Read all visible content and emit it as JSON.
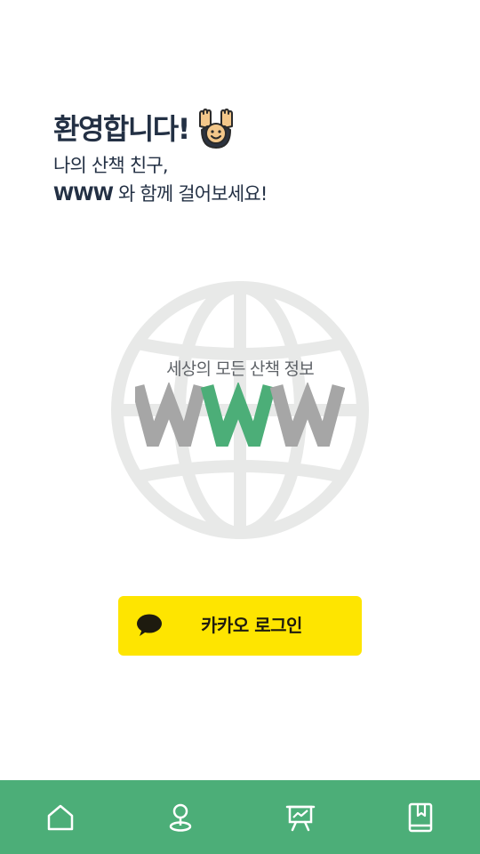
{
  "welcome": {
    "title": "환영합니다!",
    "emoji": "raising-hands-emoji",
    "line1": "나의 산책 친구,",
    "line2_brand": "WWW",
    "line2_rest": " 와 함께 걸어보세요!"
  },
  "hero": {
    "tagline": "세상의 모든 산책 정보",
    "logo_text": "WWW",
    "logo_colors": [
      "#a6a6a6",
      "#4cae78",
      "#a6a6a6"
    ],
    "globe_color": "#e8e9e8"
  },
  "login": {
    "kakao_label": "카카오 로그인",
    "icon": "speech-bubble-icon",
    "color": "#fee500"
  },
  "nav": {
    "background": "#4cae78",
    "items": [
      {
        "icon": "home-icon"
      },
      {
        "icon": "location-pin-icon"
      },
      {
        "icon": "presentation-chart-icon"
      },
      {
        "icon": "bookmark-book-icon"
      }
    ]
  }
}
